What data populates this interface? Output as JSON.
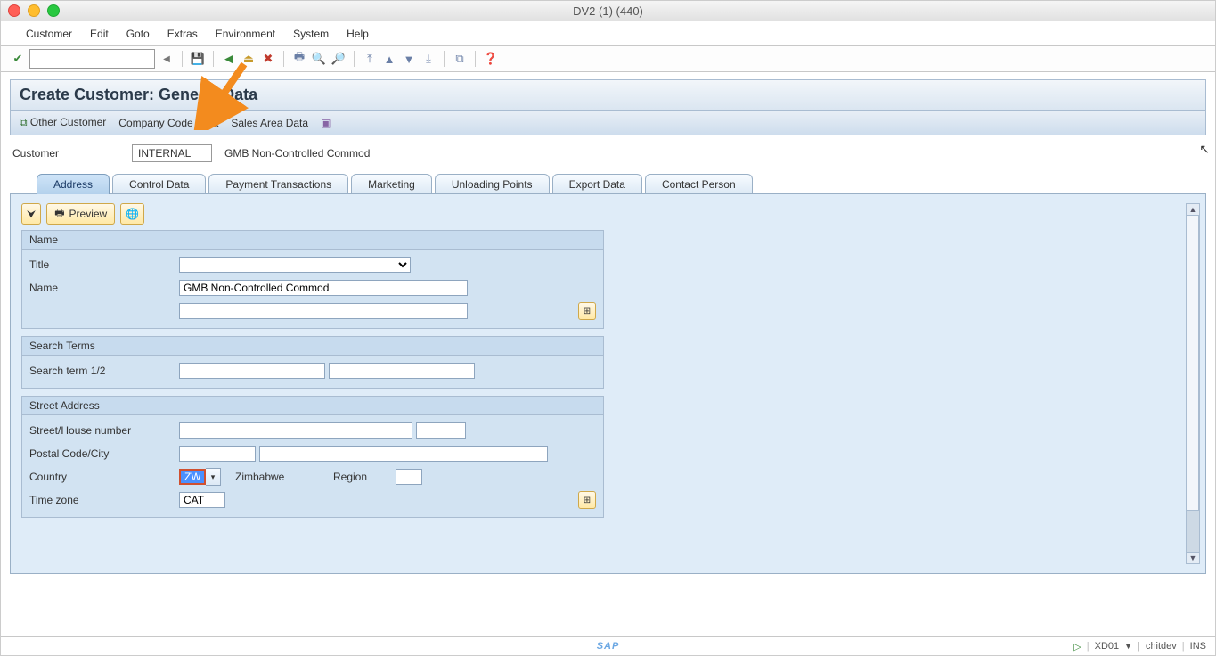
{
  "window": {
    "title": "DV2 (1) (440)"
  },
  "menubar": [
    "Customer",
    "Edit",
    "Goto",
    "Extras",
    "Environment",
    "System",
    "Help"
  ],
  "page": {
    "title": "Create Customer: General Data",
    "subbuttons": {
      "other_customer": "Other Customer",
      "company_code_data": "Company Code Data",
      "sales_area_data": "Sales Area Data"
    }
  },
  "header": {
    "customer_label": "Customer",
    "customer_value": "INTERNAL",
    "customer_name": "GMB Non-Controlled Commod"
  },
  "tabs": [
    "Address",
    "Control Data",
    "Payment Transactions",
    "Marketing",
    "Unloading Points",
    "Export Data",
    "Contact Person"
  ],
  "active_tab": "Address",
  "preview_label": "Preview",
  "groups": {
    "name": {
      "title": "Name",
      "title_label": "Title",
      "title_value": "",
      "name_label": "Name",
      "name_value": "GMB Non-Controlled Commod",
      "name2_value": ""
    },
    "search": {
      "title": "Search Terms",
      "label": "Search term 1/2",
      "term1": "",
      "term2": ""
    },
    "street": {
      "title": "Street Address",
      "street_label": "Street/House number",
      "street_value": "",
      "house_value": "",
      "postal_label": "Postal Code/City",
      "postal_value": "",
      "city_value": "",
      "country_label": "Country",
      "country_value": "ZW",
      "country_name": "Zimbabwe",
      "region_label": "Region",
      "region_value": "",
      "timezone_label": "Time zone",
      "timezone_value": "CAT"
    }
  },
  "statusbar": {
    "tcode": "XD01",
    "user": "chitdev",
    "mode": "INS"
  }
}
